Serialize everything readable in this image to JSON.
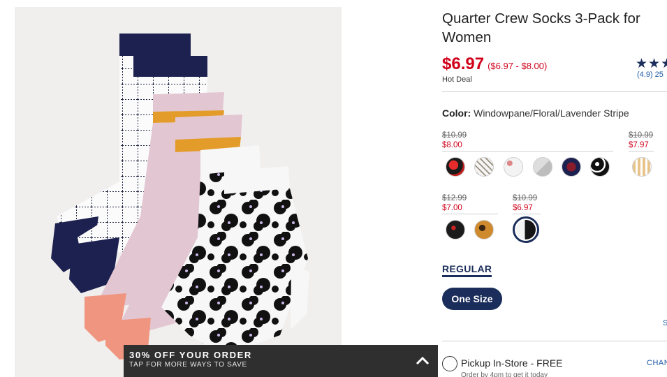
{
  "product": {
    "title": "Quarter Crew Socks 3-Pack for Women",
    "price": "$6.97",
    "price_range": "($6.97 - $8.00)",
    "badge": "Hot Deal",
    "stars": "★★★",
    "rating_text": "(4.9) 25"
  },
  "color": {
    "label": "Color:",
    "value": "Windowpane/Floral/Lavender Stripe",
    "groups": [
      {
        "original": "$10.99",
        "sale": "$8.00"
      },
      {
        "original": "$10.99",
        "sale": "$7.97"
      },
      {
        "original": "$12.99",
        "sale": "$7.00"
      },
      {
        "original": "$10.99",
        "sale": "$6.97"
      }
    ]
  },
  "fit": {
    "tab": "REGULAR",
    "size": "One Size",
    "size_link": "S"
  },
  "pickup": {
    "label": "Pickup In-Store - FREE",
    "sub": "Order by 4pm to get it today",
    "change": "CHAN"
  },
  "promo": {
    "title": "30% OFF YOUR ORDER",
    "subtitle": "TAP FOR MORE WAYS TO SAVE",
    "icon": "chevron-up-icon"
  },
  "colors": {
    "sale_red": "#d0021b",
    "navy": "#1b2d5a",
    "link_blue": "#1b5aa6",
    "banner_bg": "#2f2f2f"
  }
}
